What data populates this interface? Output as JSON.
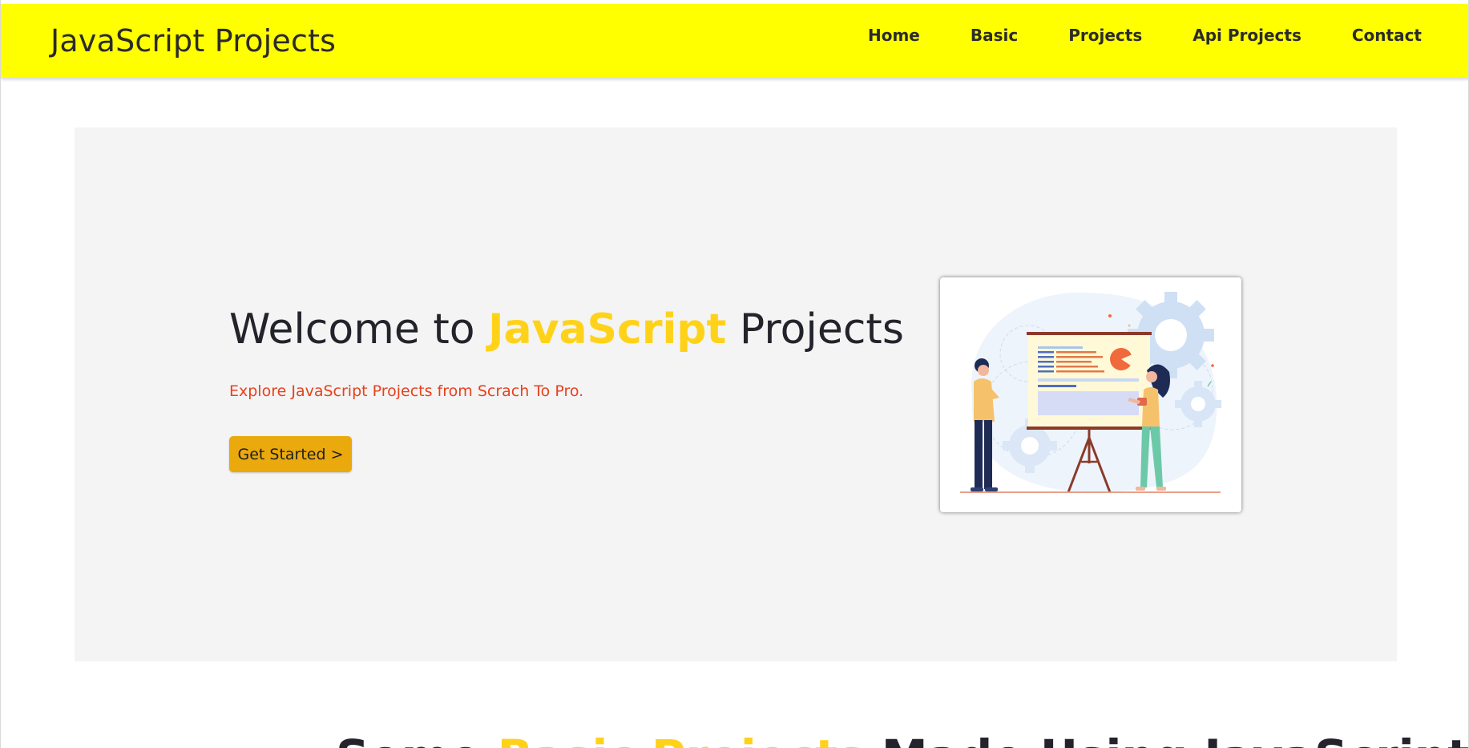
{
  "navbar": {
    "brand": "JavaScript Projects",
    "links": [
      "Home",
      "Basic",
      "Projects",
      "Api Projects",
      "Contact"
    ]
  },
  "hero": {
    "title_before": "Welcome to ",
    "title_accent": "JavaScript",
    "title_after": " Projects",
    "subtitle": "Explore JavaScript Projects from Scrach To Pro.",
    "cta_label": "Get Started >",
    "illustration": "presentation-illustration"
  },
  "section": {
    "title_before": "Some ",
    "title_accent": "Basic Projects",
    "title_after": " Made Using JavaScript"
  },
  "colors": {
    "navbar_bg": "#ffff00",
    "accent": "#ffd21a",
    "subtitle": "#e8401c",
    "button": "#eaa90c",
    "hero_bg": "#f4f4f4"
  }
}
